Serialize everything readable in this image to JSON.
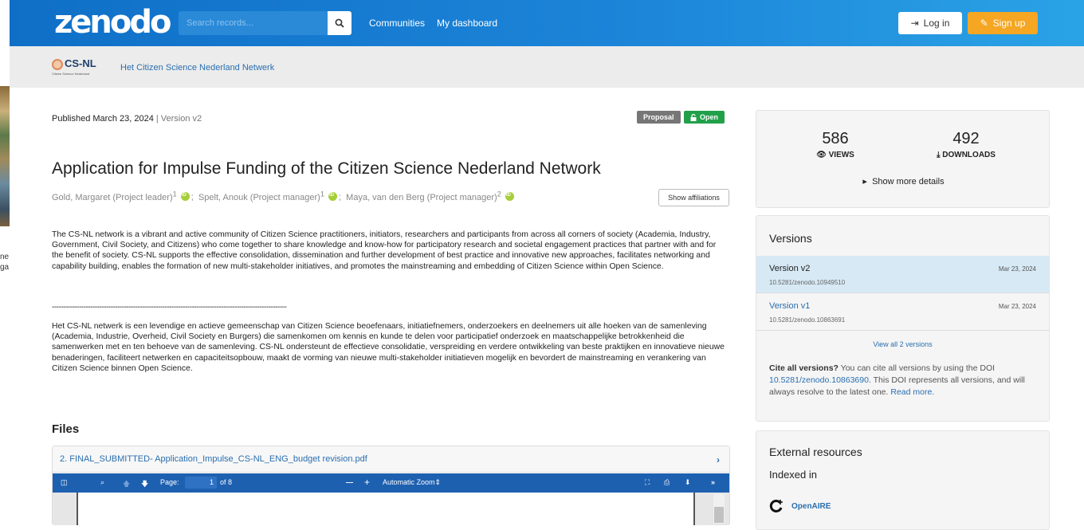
{
  "edge": {
    "line1": "ne",
    "line2": "ga"
  },
  "header": {
    "logo": "zenodo",
    "search_placeholder": "Search records...",
    "nav": [
      "Communities",
      "My dashboard"
    ],
    "login": "Log in",
    "signup": "Sign up"
  },
  "community": {
    "logo_text": "CS-NL",
    "logo_sub": "Citizen Science Nederland",
    "name": "Het Citizen Science Nederland Netwerk"
  },
  "record": {
    "published": "Published March 23, 2024",
    "separator": " | ",
    "version": "Version v2",
    "badge_type": "Proposal",
    "badge_access": "Open",
    "title": "Application for Impulse Funding of the Citizen Science Nederland Network",
    "authors": [
      {
        "name": "Gold, Margaret (Project leader)",
        "sup": "1",
        "sep": ";"
      },
      {
        "name": "Spelt, Anouk (Project manager)",
        "sup": "1",
        "sep": ";"
      },
      {
        "name": "Maya, van den Berg (Project manager)",
        "sup": "2",
        "sep": ""
      }
    ],
    "show_affiliations": "Show affiliations",
    "description_en": "The CS-NL network is a vibrant and active community of Citizen Science practitioners, initiators, researchers and participants from across all corners of society (Academia, Industry, Government, Civil Society, and Citizens) who come together to share knowledge and know-how for participatory research and societal engagement practices that partner with and for the benefit of society.  CS-NL supports the effective consolidation, dissemination and further development of best practice and innovative new approaches, facilitates networking and capability building, enables the formation of new multi-stakeholder initiatives, and promotes the mainstreaming and embedding of Citizen Science within Open Science.",
    "divider": "--------------------------------------------------------------------------------------------------------",
    "description_nl": "Het CS-NL netwerk is een levendige en actieve gemeenschap van Citizen Science beoefenaars, initiatiefnemers, onderzoekers en deelnemers uit alle hoeken van de samenleving (Academia, Industrie, Overheid, Civil Society en Burgers) die samenkomen om kennis en kunde te delen voor participatief onderzoek en maatschappelijke betrokkenheid die samenwerken met en ten behoeve van de samenleving.  CS-NL ondersteunt de effectieve consolidatie, verspreiding en verdere ontwikkeling van beste praktijken en innovatieve nieuwe benaderingen, faciliteert netwerken en capaciteitsopbouw, maakt de vorming van nieuwe multi-stakeholder initiatieven mogelijk en bevordert de mainstreaming en verankering van Citizen Science binnen Open Science."
  },
  "files": {
    "heading": "Files",
    "filename": "2. FINAL_SUBMITTED- Application_Impulse_CS-NL_ENG_budget revision.pdf",
    "viewer": {
      "page_label": "Page:",
      "page": "1",
      "of": "of 8",
      "zoom": "Automatic Zoom"
    }
  },
  "stats": {
    "views": "586",
    "views_label": "VIEWS",
    "downloads": "492",
    "downloads_label": "DOWNLOADS",
    "more": "Show more details"
  },
  "versions": {
    "heading": "Versions",
    "items": [
      {
        "name": "Version v2",
        "date": "Mar 23, 2024",
        "doi": "10.5281/zenodo.10949510"
      },
      {
        "name": "Version v1",
        "date": "Mar 23, 2024",
        "doi": "10.5281/zenodo.10863691"
      }
    ],
    "view_all": "View all 2 versions",
    "cite_bold": "Cite all versions?",
    "cite_text1": " You can cite all versions by using the DOI ",
    "cite_doi": "10.5281/zenodo.10863690",
    "cite_text2": ". This DOI represents all versions, and will always resolve to the latest one. ",
    "read_more": "Read more."
  },
  "external": {
    "heading": "External resources",
    "indexed": "Indexed in",
    "openaire": "OpenAIRE"
  },
  "colors": {
    "header": "#1d86d9",
    "signup": "#f5a623",
    "open_badge": "#21a04a",
    "link": "#2a6fb0"
  }
}
